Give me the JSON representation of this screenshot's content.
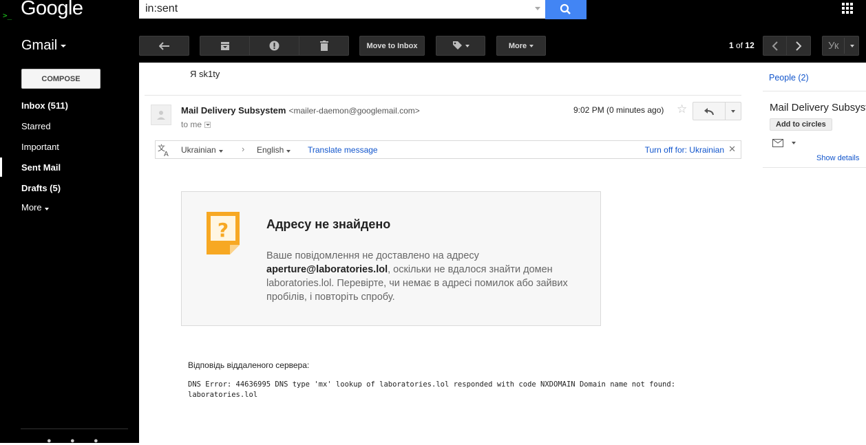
{
  "header": {
    "logo": "Google",
    "terminal_mark": ">_",
    "search": {
      "value": "in:sent",
      "placeholder": ""
    }
  },
  "toolbar": {
    "app_name": "Gmail",
    "move_to_inbox": "Move to Inbox",
    "more": "More",
    "pager_current": "1",
    "pager_of": "of",
    "pager_total": "12",
    "language_short": "Ук"
  },
  "sidebar": {
    "compose": "COMPOSE",
    "items": [
      {
        "label": "Inbox (511)",
        "bold": true
      },
      {
        "label": "Starred",
        "bold": false
      },
      {
        "label": "Important",
        "bold": false
      },
      {
        "label": "Sent Mail",
        "bold": true
      },
      {
        "label": "Drafts (5)",
        "bold": true
      },
      {
        "label": "More",
        "bold": false
      }
    ]
  },
  "message": {
    "previous_body": "Я sk1ty",
    "sender_name": "Mail Delivery Subsystem",
    "sender_email": "<mailer-daemon@googlemail.com>",
    "to": "to me",
    "time": "9:02 PM (0 minutes ago)",
    "translate": {
      "from": "Ukrainian",
      "to": "English",
      "link": "Translate message",
      "turn_off": "Turn off for: Ukrainian"
    },
    "card": {
      "title": "Адресу не знайдено",
      "text_before": "Ваше повідомлення не доставлено на адресу",
      "address": "aperture@laboratories.lol",
      "text_after": ", оскільки не вдалося знайти домен laboratories.lol. Перевірте, чи немає в адресі помилок або зайвих пробілів, і повторіть спробу."
    },
    "server_label": "Відповідь віддаленого сервера:",
    "server_text": "DNS Error: 44636995 DNS type 'mx' lookup of laboratories.lol responded with code NXDOMAIN Domain name not found: laboratories.lol"
  },
  "right_panel": {
    "people": "People (2)",
    "contact_name": "Mail Delivery Subsystem",
    "add_to_circles": "Add to circles",
    "show_details": "Show details"
  },
  "colors": {
    "search_button": "#4285f4",
    "link": "#1155cc",
    "card_icon": "#f7a823"
  }
}
